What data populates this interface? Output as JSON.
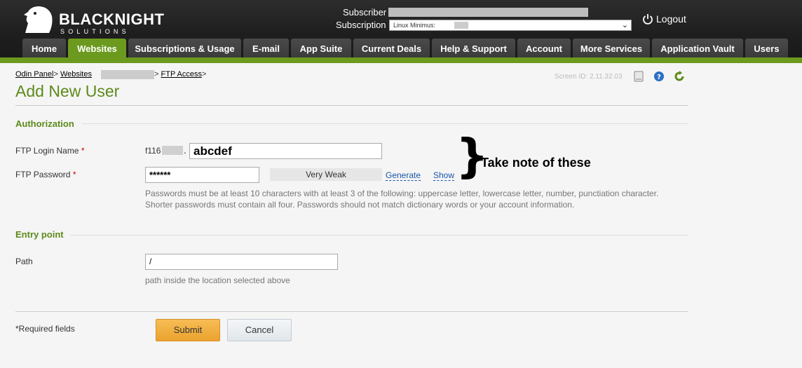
{
  "header": {
    "brand": "BLACKNIGHT",
    "brand_sub": "SOLUTIONS",
    "subscriber_label": "Subscriber",
    "subscription_label": "Subscription",
    "subscription_value": "Linux Minimus:",
    "logout_label": "Logout"
  },
  "tabs": [
    {
      "label": "Home"
    },
    {
      "label": "Websites"
    },
    {
      "label": "Subscriptions & Usage"
    },
    {
      "label": "E-mail"
    },
    {
      "label": "App Suite"
    },
    {
      "label": "Current Deals"
    },
    {
      "label": "Help & Support"
    },
    {
      "label": "Account"
    },
    {
      "label": "More Services"
    },
    {
      "label": "Application Vault"
    },
    {
      "label": "Users"
    }
  ],
  "breadcrumb": {
    "items": [
      "Odin Panel",
      "Websites",
      "FTP Access"
    ],
    "separator": ">"
  },
  "screen_id": "Screen ID:  2.11.32.03",
  "page_title": "Add New User",
  "authorization": {
    "title": "Authorization",
    "login_label": "FTP Login Name",
    "login_prefix": "f116",
    "login_value": "abcdef",
    "password_label": "FTP Password",
    "password_value": "******",
    "strength": "Very Weak",
    "generate_label": "Generate",
    "show_label": "Show",
    "hint": "Passwords must be at least 10 characters with at least 3 of the following: uppercase letter, lowercase letter, number, punctiation character. Shorter passwords must contain all four. Passwords should not match dictionary words or your account information.",
    "required_mark": "*"
  },
  "annotation": "Take note of these",
  "entry_point": {
    "title": "Entry point",
    "path_label": "Path",
    "path_value": "/",
    "path_hint": "path inside the location selected above"
  },
  "footer": {
    "required_fields": "*Required fields",
    "submit_label": "Submit",
    "cancel_label": "Cancel"
  },
  "colors": {
    "brand_green": "#6b9a1e",
    "title_green": "#5d8a1a",
    "submit_orange": "#eba22e"
  }
}
